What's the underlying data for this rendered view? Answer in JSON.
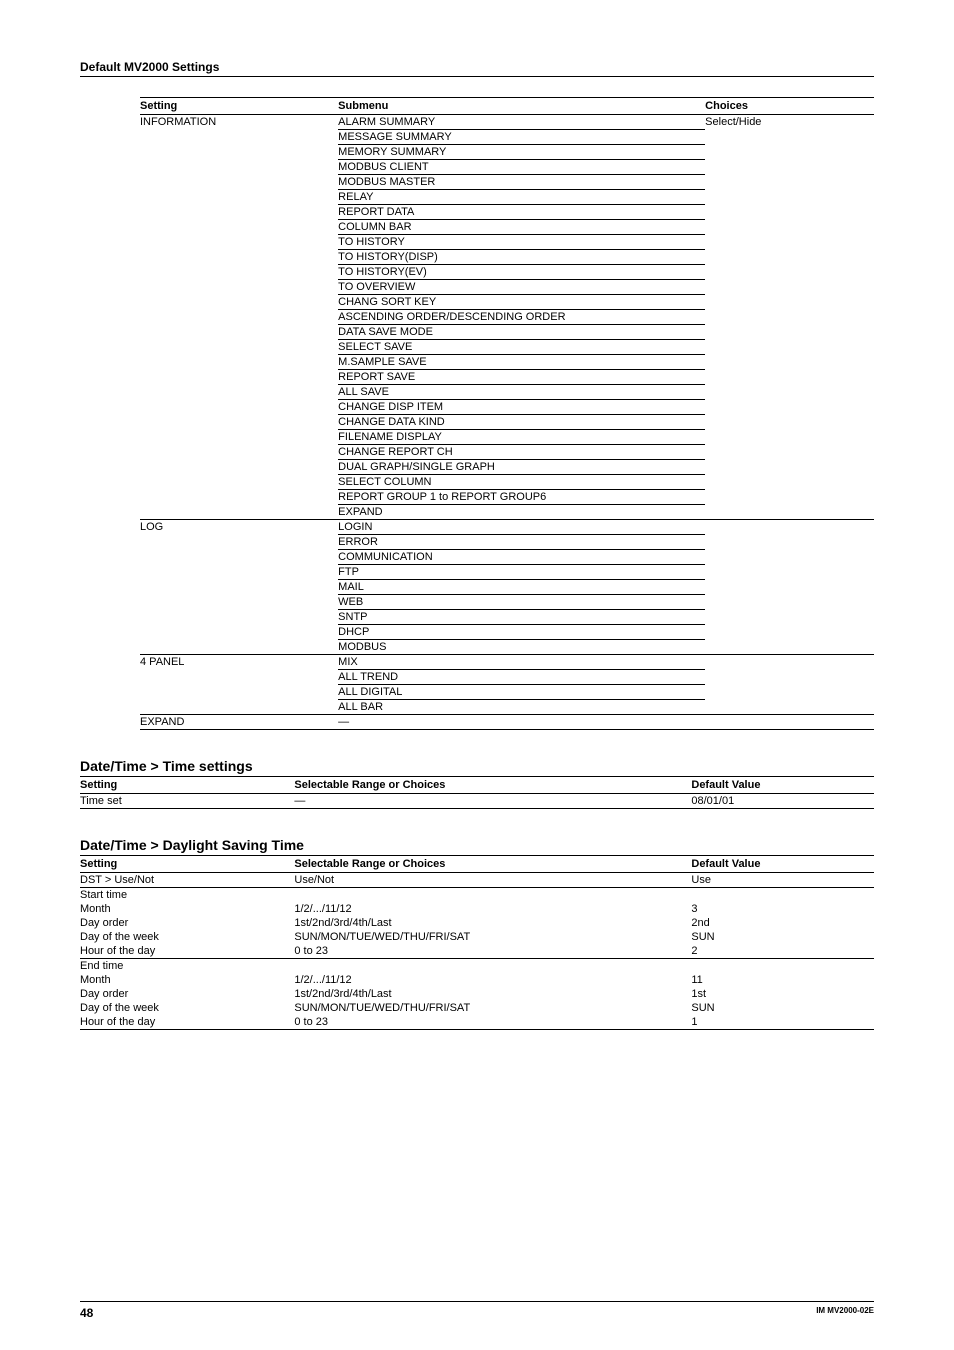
{
  "pageTitle": "Default MV2000 Settings",
  "table1": {
    "headers": [
      "Setting",
      "Submenu",
      "Choices"
    ],
    "groups": [
      {
        "setting": "INFORMATION",
        "choices": "Select/Hide",
        "rows": [
          "ALARM SUMMARY",
          "MESSAGE SUMMARY",
          "MEMORY SUMMARY",
          "MODBUS CLIENT",
          "MODBUS MASTER",
          "RELAY",
          "REPORT DATA",
          "COLUMN BAR",
          "TO HISTORY",
          "TO HISTORY(DISP)",
          "TO HISTORY(EV)",
          "TO OVERVIEW",
          "CHANG SORT KEY",
          "ASCENDING ORDER/DESCENDING ORDER",
          "DATA SAVE MODE",
          "SELECT SAVE",
          "M.SAMPLE SAVE",
          "REPORT SAVE",
          "ALL SAVE",
          "CHANGE DISP ITEM",
          "CHANGE DATA KIND",
          "FILENAME DISPLAY",
          "CHANGE REPORT CH",
          "DUAL GRAPH/SINGLE GRAPH",
          "SELECT COLUMN",
          "REPORT GROUP 1 to REPORT GROUP6",
          "EXPAND"
        ],
        "topBorder": false
      },
      {
        "setting": "LOG",
        "choices": "",
        "rows": [
          "LOGIN",
          "ERROR",
          "COMMUNICATION",
          "FTP",
          "MAIL",
          "WEB",
          "SNTP",
          "DHCP",
          "MODBUS"
        ],
        "topBorder": true
      },
      {
        "setting": "4 PANEL",
        "choices": "",
        "rows": [
          "MIX",
          "ALL TREND",
          "ALL DIGITAL",
          "ALL BAR"
        ],
        "topBorder": true
      },
      {
        "setting": "EXPAND",
        "choices": "",
        "rows": [
          "—"
        ],
        "topBorder": true,
        "noUnderlineSubmenu": true,
        "fullBottom": true
      }
    ]
  },
  "section2": {
    "title": "Date/Time > Time settings",
    "headers": [
      "Setting",
      "Selectable Range or Choices",
      "Default Value"
    ],
    "rows": [
      {
        "c": [
          "Time set",
          "—",
          "08/01/01"
        ],
        "bb": true
      }
    ]
  },
  "section3": {
    "title": "Date/Time > Daylight Saving Time",
    "headers": [
      "Setting",
      "Selectable Range or Choices",
      "Default Value"
    ],
    "rows": [
      {
        "c": [
          "DST > Use/Not",
          "Use/Not",
          "Use"
        ],
        "bb": true
      },
      {
        "c": [
          "Start time",
          "",
          ""
        ],
        "bb": false
      },
      {
        "c": [
          "Month",
          "1/2/.../11/12",
          "3"
        ],
        "bb": false
      },
      {
        "c": [
          "Day order",
          "1st/2nd/3rd/4th/Last",
          "2nd"
        ],
        "bb": false
      },
      {
        "c": [
          "Day of the week",
          "SUN/MON/TUE/WED/THU/FRI/SAT",
          "SUN"
        ],
        "bb": false
      },
      {
        "c": [
          "Hour of the day",
          "0 to 23",
          "2"
        ],
        "bb": true
      },
      {
        "c": [
          "End time",
          "",
          ""
        ],
        "bb": false
      },
      {
        "c": [
          "Month",
          "1/2/.../11/12",
          "11"
        ],
        "bb": false
      },
      {
        "c": [
          "Day order",
          "1st/2nd/3rd/4th/Last",
          "1st"
        ],
        "bb": false
      },
      {
        "c": [
          "Day of the week",
          "SUN/MON/TUE/WED/THU/FRI/SAT",
          "SUN"
        ],
        "bb": false
      },
      {
        "c": [
          "Hour of the day",
          "0 to 23",
          "1"
        ],
        "bb": true
      }
    ]
  },
  "footer": {
    "page": "48",
    "doc": "IM MV2000-02E"
  }
}
